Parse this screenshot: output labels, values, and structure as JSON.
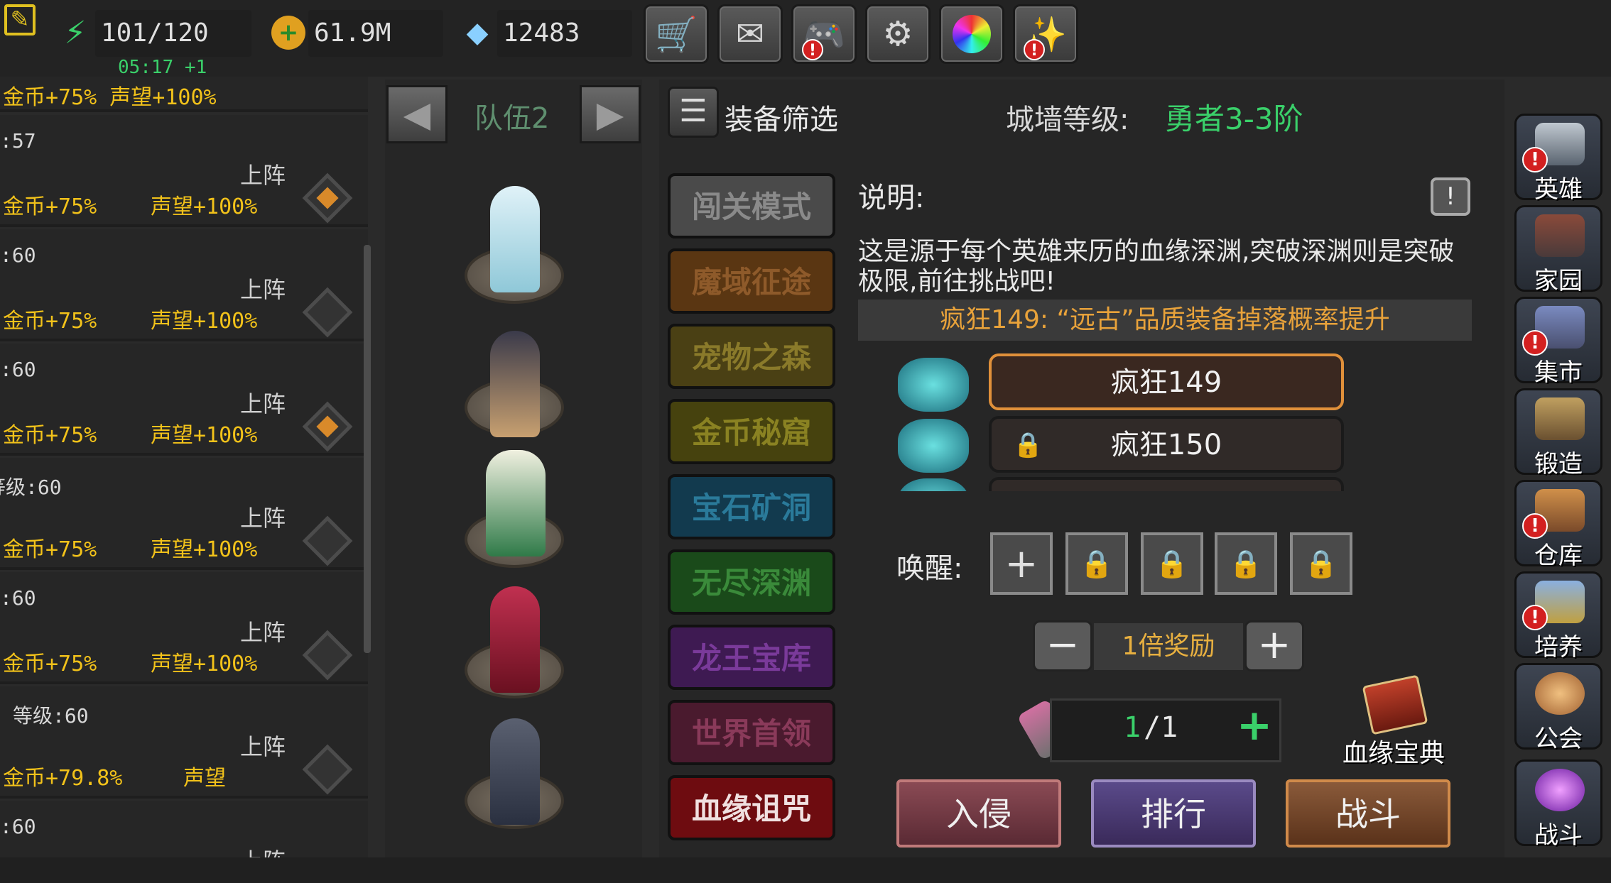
{
  "topbar": {
    "energy": "101/120",
    "energy_timer": "05:17 +1",
    "gold": "61.9M",
    "diamonds": "12483",
    "buttons": [
      {
        "icon": "cart-icon",
        "alert": false
      },
      {
        "icon": "mail-icon",
        "alert": false
      },
      {
        "icon": "gamepad-icon",
        "alert": true
      },
      {
        "icon": "gear-icon",
        "alert": false
      },
      {
        "icon": "color-wheel-icon",
        "alert": false
      },
      {
        "icon": "firework-icon",
        "alert": true
      }
    ]
  },
  "left_list": {
    "top_partial": "金币+75%   声望+100%",
    "rows": [
      {
        "level": ":57",
        "onstage": "上阵",
        "gold": "金币+75%",
        "fame": "声望+100%",
        "active": true
      },
      {
        "level": ":60",
        "onstage": "上阵",
        "gold": "金币+75%",
        "fame": "声望+100%",
        "active": false
      },
      {
        "level": ":60",
        "onstage": "上阵",
        "gold": "金币+75%",
        "fame": "声望+100%",
        "active": true
      },
      {
        "level": "等级:60",
        "onstage": "上阵",
        "gold": "金币+75%",
        "fame": "声望+100%",
        "active": false
      },
      {
        "level": ":60",
        "onstage": "上阵",
        "gold": "金币+75%",
        "fame": "声望+100%",
        "active": false
      },
      {
        "level": "等级:60",
        "onstage": "上阵",
        "gold": "金币+79.8%",
        "fame": "声望",
        "active": false
      },
      {
        "level": ":60",
        "onstage": "上阵",
        "gold": "",
        "fame": "",
        "active": false
      }
    ]
  },
  "team": {
    "name": "队伍2"
  },
  "header": {
    "filter_label": "装备筛选",
    "wall_label": "城墙等级:",
    "wall_value": "勇者3-3阶"
  },
  "modes": [
    {
      "label": "闯关模式"
    },
    {
      "label": "魔域征途"
    },
    {
      "label": "宠物之森"
    },
    {
      "label": "金币秘窟"
    },
    {
      "label": "宝石矿洞"
    },
    {
      "label": "无尽深渊"
    },
    {
      "label": "龙王宝库"
    },
    {
      "label": "世界首领"
    },
    {
      "label": "血缘诅咒"
    }
  ],
  "description": {
    "title": "说明:",
    "text": "这是源于每个英雄来历的血缘深渊,突破深渊则是突破极限,前往挑战吧!",
    "banner": "疯狂149: “远古”品质装备掉落概率提升"
  },
  "levels": [
    {
      "label": "疯狂149",
      "locked": false
    },
    {
      "label": "疯狂150",
      "locked": true
    }
  ],
  "awaken": {
    "label": "唤醒:"
  },
  "reward": {
    "label": "1倍奖励"
  },
  "tickets": {
    "current": "1",
    "total": "/1"
  },
  "codex": {
    "label": "血缘宝典"
  },
  "actions": {
    "invade": "入侵",
    "rank": "排行",
    "fight": "战斗"
  },
  "sidebar": [
    {
      "label": "英雄",
      "icon": "helmet-icon",
      "alert": true
    },
    {
      "label": "家园",
      "icon": "castle-icon",
      "alert": false
    },
    {
      "label": "集市",
      "icon": "market-icon",
      "alert": true
    },
    {
      "label": "锻造",
      "icon": "anvil-icon",
      "alert": false
    },
    {
      "label": "仓库",
      "icon": "storage-icon",
      "alert": true
    },
    {
      "label": "培养",
      "icon": "chalice-icon",
      "alert": true
    },
    {
      "label": "公会",
      "icon": "guild-icon",
      "alert": false
    },
    {
      "label": "战斗",
      "icon": "portal-icon",
      "alert": false
    }
  ]
}
